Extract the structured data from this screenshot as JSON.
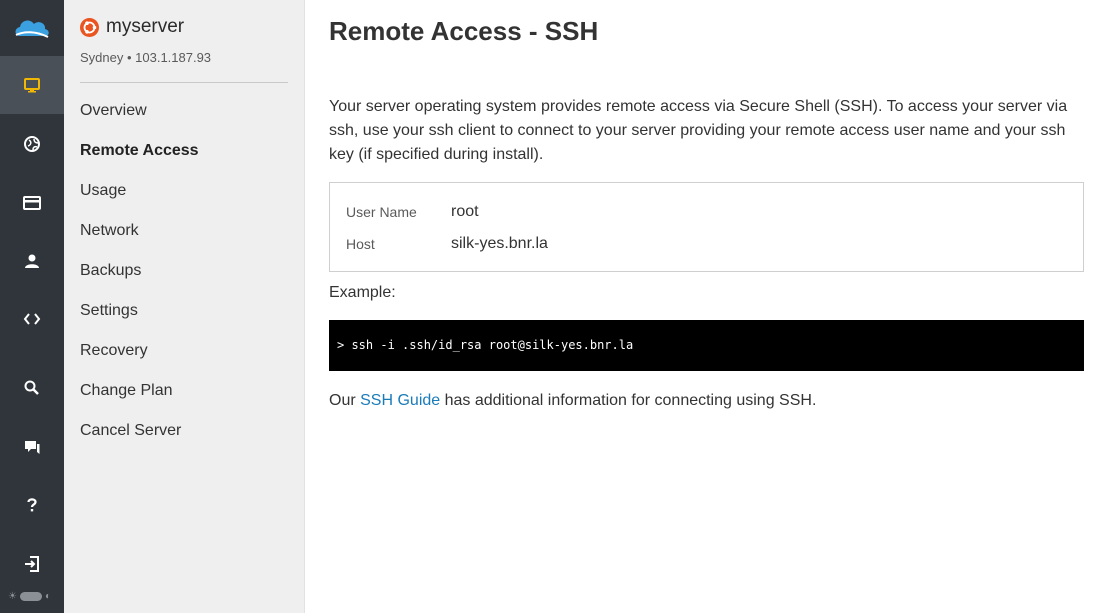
{
  "server": {
    "name": "myserver",
    "meta": "Sydney • 103.1.187.93"
  },
  "rail": {
    "items": [
      {
        "icon": "monitor-icon",
        "active": true
      },
      {
        "icon": "globe-icon",
        "active": false
      },
      {
        "icon": "credit-card-icon",
        "active": false
      },
      {
        "icon": "user-icon",
        "active": false
      },
      {
        "icon": "code-icon",
        "active": false
      },
      {
        "icon": "search-icon",
        "active": false
      },
      {
        "icon": "chat-icon",
        "active": false
      },
      {
        "icon": "help-icon",
        "active": false
      },
      {
        "icon": "logout-icon",
        "active": false
      }
    ],
    "accent": "#f2b705"
  },
  "nav": {
    "items": [
      "Overview",
      "Remote Access",
      "Usage",
      "Network",
      "Backups",
      "Settings",
      "Recovery",
      "Change Plan",
      "Cancel Server"
    ],
    "active": "Remote Access"
  },
  "main": {
    "title": "Remote Access - SSH",
    "intro": "Your server operating system provides remote access via Secure Shell (SSH). To access your server via ssh, use your ssh client to connect to your server providing your remote access user name and your ssh key (if specified during install).",
    "credentials": {
      "user_label": "User Name",
      "user_value": "root",
      "host_label": "Host",
      "host_value": "silk-yes.bnr.la"
    },
    "example_label": "Example:",
    "example_command": "> ssh -i .ssh/id_rsa root@silk-yes.bnr.la",
    "footer_prefix": "Our ",
    "footer_link": "SSH Guide",
    "footer_suffix": " has additional information for connecting using SSH."
  },
  "colors": {
    "rail_bg": "#2f353b",
    "link": "#1a7bb9",
    "os_icon": "#e95420"
  }
}
